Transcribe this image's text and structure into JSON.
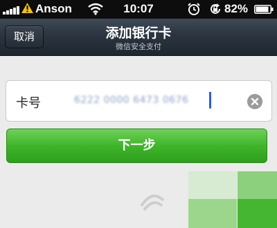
{
  "status_bar": {
    "carrier": "Anson",
    "time": "10:07",
    "battery_percent": "82%",
    "icons": [
      "signal-icon",
      "warning-icon",
      "wifi-icon",
      "alarm-icon",
      "rotation-lock-icon",
      "battery-icon"
    ]
  },
  "navbar": {
    "cancel_label": "取消",
    "title": "添加银行卡",
    "subtitle": "微信安全支付"
  },
  "card_form": {
    "label": "卡号",
    "value": "6222 0000 6473 0676"
  },
  "actions": {
    "next_label": "下一步"
  },
  "colors": {
    "button_green": "#3fb52a",
    "navbar_dark": "#2b3440",
    "caret_blue": "#2b5fd9"
  }
}
